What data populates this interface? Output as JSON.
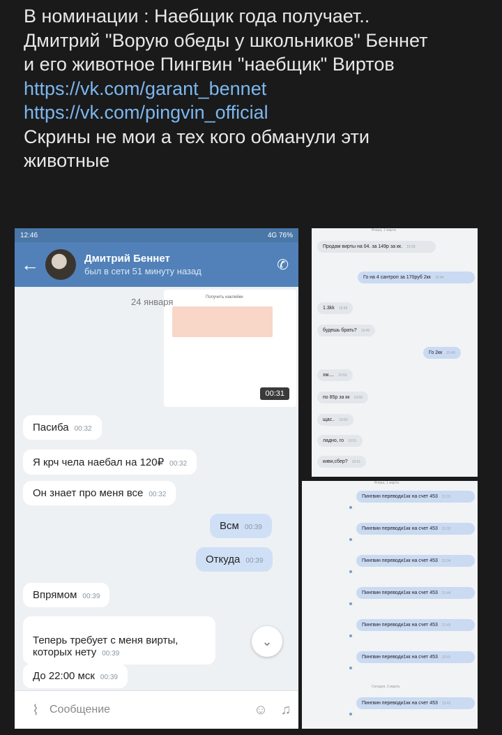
{
  "post": {
    "lines": [
      "В номинации : Наебщик года получает..",
      "Дмитрий \"Ворую обеды у школьников\" Беннет",
      "и его животное Пингвин \"наебщик\" Виртов"
    ],
    "links": [
      "https://vk.com/garant_bennet",
      "https://vk.com/pingvin_official"
    ],
    "footer": [
      "Скрины не мои а тех кого обманули эти",
      "животные"
    ]
  },
  "phone": {
    "status_time": "12:46",
    "status_right": "4G 76%",
    "contact_name": "Дмитрий Беннет",
    "last_seen": "был в сети 51 минуту назад",
    "date_divider": "24 января",
    "video_duration": "00:31",
    "compose_placeholder": "Сообщение",
    "messages": [
      {
        "text": "Пасиба",
        "time": "00:32"
      },
      {
        "text": "Я крч чела наебал на 120₽",
        "time": "00:32"
      },
      {
        "text": "Он знает про меня все",
        "time": "00:32"
      },
      {
        "text": "Всм",
        "time": "00:39"
      },
      {
        "text": "Откуда",
        "time": "00:39"
      },
      {
        "text": "Впрямом",
        "time": "00:39"
      },
      {
        "text": "Теперь требует с меня вирты,\nкоторых нету",
        "time": "00:39"
      },
      {
        "text": "До 22:00 мск",
        "time": "00:39"
      }
    ]
  },
  "shot1": {
    "header": "Вчера, 1 марта",
    "messages": [
      {
        "text": "Продам вирты на 04. за 149р за кк.",
        "time": "19:28"
      },
      {
        "text": "Го на 4 сантроп за 170руб 2кк",
        "time": "19:44"
      },
      {
        "text": "1.3kk",
        "time": "19:49"
      },
      {
        "text": "будешь брать?",
        "time": "19:49"
      },
      {
        "text": "Го 2кк",
        "time": "19:49"
      },
      {
        "text": "хм....",
        "time": "19:50"
      },
      {
        "text": "по 85р за кк",
        "time": "19:50"
      },
      {
        "text": "щас..",
        "time": "19:50"
      },
      {
        "text": "ладно, го",
        "time": "19:51"
      },
      {
        "text": "киви,сбер?",
        "time": "19:51"
      }
    ]
  },
  "shot2": {
    "header": "Вчера, 1 марта",
    "today": "Сегодня, 2 марта",
    "messages": [
      {
        "text": "Пингвин переводи1кк на счет 453",
        "time": "21:31"
      },
      {
        "text": "Пингвин переводи1кк на счет 453",
        "time": "21:32"
      },
      {
        "text": "Пингвин переводи1кк на счет 453",
        "time": "21:34"
      },
      {
        "text": "Пингвин переводи1кк на счет 453",
        "time": "21:44"
      },
      {
        "text": "Пингвин переводи1кк на счет 453",
        "time": "21:45"
      },
      {
        "text": "Пингвин переводи1кк на счет 453",
        "time": "22:01"
      },
      {
        "text": "Пингвин переводи1кк на счет 453",
        "time": "13:42"
      }
    ]
  }
}
